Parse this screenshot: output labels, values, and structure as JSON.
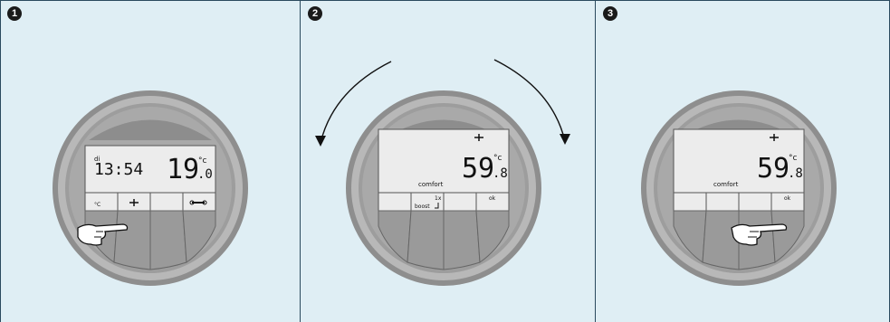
{
  "panels": [
    {
      "step": "1",
      "display": {
        "day": "di",
        "time": "13:54",
        "temp_main": "19",
        "temp_decimal": ".0",
        "unit": "°c",
        "softkeys": [
          "°C",
          "",
          "",
          ""
        ]
      }
    },
    {
      "step": "2",
      "display": {
        "mode": "comfort",
        "temp_main": "59",
        "temp_decimal": ".8",
        "unit": "°c",
        "softkeys": [
          "",
          "boost",
          "",
          "ok"
        ],
        "softkey_extra": "1x"
      }
    },
    {
      "step": "3",
      "display": {
        "mode": "comfort",
        "temp_main": "59",
        "temp_decimal": ".8",
        "unit": "°c",
        "softkeys": [
          "",
          "",
          "",
          "ok"
        ]
      }
    }
  ],
  "colors": {
    "background": "#dfeef4",
    "border": "#2b4a5e",
    "ring_outer": "#8e8e8e",
    "ring_inner": "#b5b5b5",
    "screen": "#ececec"
  }
}
